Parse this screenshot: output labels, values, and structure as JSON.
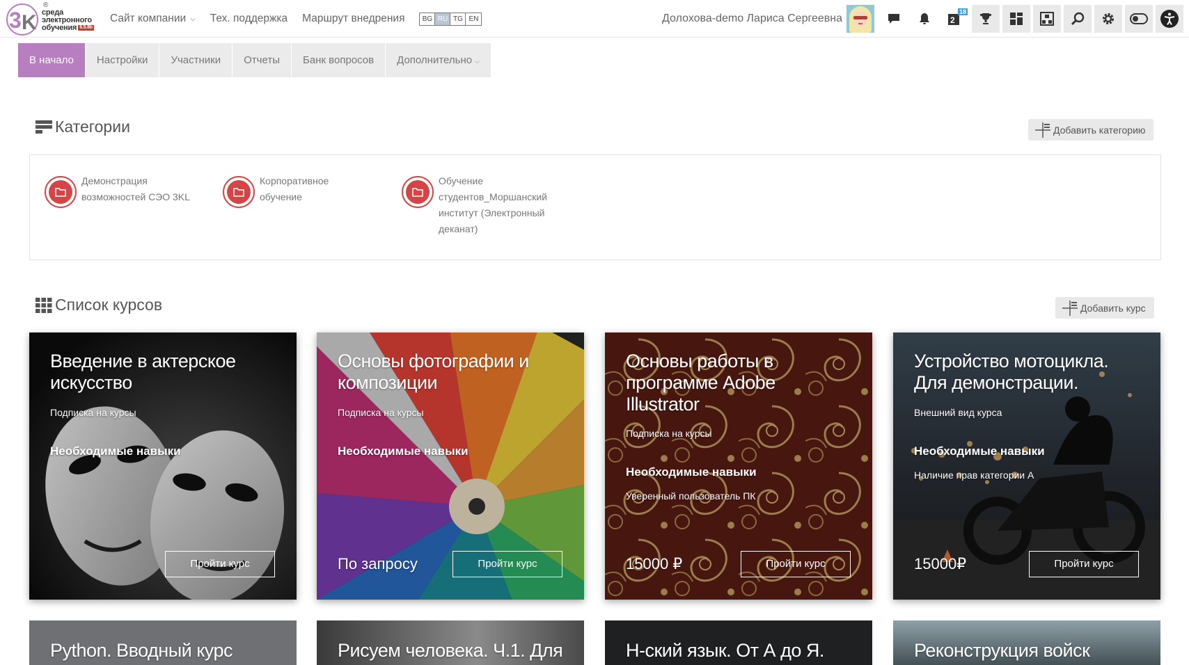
{
  "logo": {
    "line1": "среда",
    "line2": "электронного",
    "line3": "обучения",
    "version": "6.5.8b",
    "registered": "®"
  },
  "topnav": {
    "company_site": "Сайт компании",
    "support": "Тех. поддержка",
    "route": "Маршрут внедрения",
    "languages": [
      "BG",
      "RU",
      "TG",
      "EN"
    ],
    "active_language": "RU"
  },
  "user": {
    "name": "Долохова-demo Лариса Сергеевна",
    "tasks_badge": "18"
  },
  "menu": {
    "items": [
      "В начало",
      "Настройки",
      "Участники",
      "Отчеты",
      "Банк вопросов",
      "Дополнительно"
    ],
    "active": "В начало"
  },
  "categories": {
    "title": "Категории",
    "add_label": "Добавить категорию",
    "items": [
      {
        "l1": "Демонстрация",
        "l2": "возможностей СЭО 3KL",
        "l3": "",
        "l4": ""
      },
      {
        "l1": "Корпоративное",
        "l2": "обучение",
        "l3": "",
        "l4": ""
      },
      {
        "l1": "Обучение",
        "l2": "студентов_Моршанский",
        "l3": "институт (Электронный",
        "l4": "деканат)"
      }
    ]
  },
  "courses": {
    "title": "Список курсов",
    "add_label": "Добавить курс",
    "items": [
      {
        "t1": "Введение в актерское",
        "t2": "искусство",
        "t3": "",
        "subtitle": "Подписка на курсы",
        "skills_label": "Необходимые навыки",
        "skills": "",
        "price": "",
        "button": "Пройти курс"
      },
      {
        "t1": "Основы фотографии и",
        "t2": "композиции",
        "t3": "",
        "subtitle": "Подписка на курсы",
        "skills_label": "Необходимые навыки",
        "skills": "",
        "price": "По запросу",
        "button": "Пройти курс"
      },
      {
        "t1": "Основы работы в",
        "t2": "программе Adobe",
        "t3": "Illustrator",
        "subtitle": "Подписка на курсы",
        "skills_label": "Необходимые навыки",
        "skills": "Уверенный пользователь ПК",
        "price": "15000 ₽",
        "button": "Пройти курс"
      },
      {
        "t1": "Устройство мотоцикла.",
        "t2": "Для демонстрации.",
        "t3": "",
        "subtitle": "Внешний вид курса",
        "skills_label": "Необходимые навыки",
        "skills": "Наличие прав категории А",
        "price": "15000₽",
        "button": "Пройти курс"
      }
    ],
    "second_row": [
      "Python. Вводный курс",
      "Рисуем человека. Ч.1. Для",
      "Н-ский язык. От А до Я.",
      "Реконструкция войск"
    ]
  }
}
